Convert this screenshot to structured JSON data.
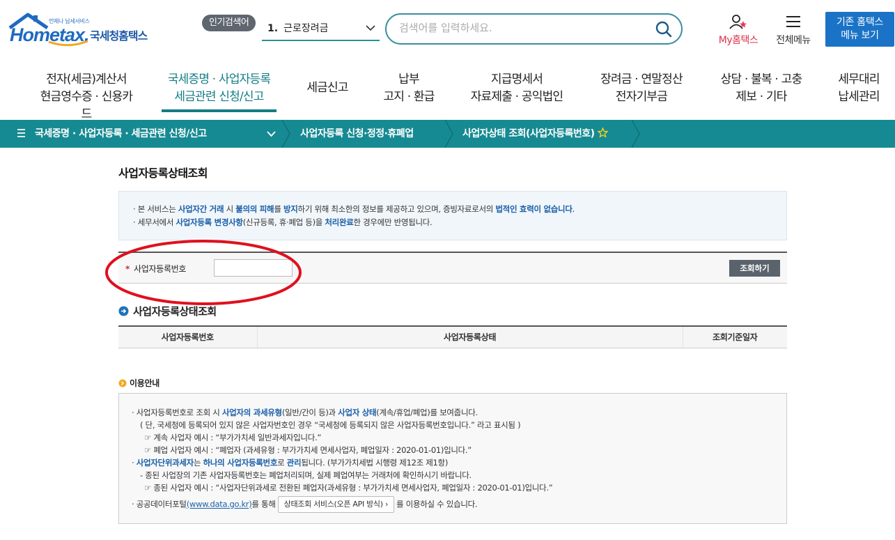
{
  "header": {
    "logo_small": "언제나 납세서비스",
    "logo_word": "Hometax.",
    "logo_kor": "국세청홈택스",
    "popular_badge": "인기검색어",
    "popular_rank": "1.",
    "popular_term": "근로장려금",
    "search_placeholder": "검색어를 입력하세요.",
    "myhome_label": "My홈택스",
    "allmenu_label": "전체메뉴",
    "legacy_line1": "기존 홈택스",
    "legacy_line2": "메뉴 보기"
  },
  "gnb": [
    {
      "line1": "전자(세금)계산서",
      "line2": "현금영수증 · 신용카드"
    },
    {
      "line1": "국세증명 · 사업자등록",
      "line2": "세금관련 신청/신고"
    },
    {
      "line1": "세금신고",
      "line2": ""
    },
    {
      "line1": "납부",
      "line2": "고지 · 환급"
    },
    {
      "line1": "지급명세서",
      "line2": "자료제출 · 공익법인"
    },
    {
      "line1": "장려금 · 연말정산",
      "line2": "전자기부금"
    },
    {
      "line1": "상담 · 불복 · 고충",
      "line2": "제보 · 기타"
    },
    {
      "line1": "세무대리",
      "line2": "납세관리"
    }
  ],
  "breadcrumb": [
    "국세증명 · 사업자등록 · 세금관련 신청/신고",
    "사업자등록 신청·정정·휴폐업",
    "사업자상태 조회(사업자등록번호)"
  ],
  "page": {
    "title": "사업자등록상태조회",
    "notice": {
      "l1_a": "본 서비스는 ",
      "l1_b": "사업자간 거래",
      "l1_c": " 시 ",
      "l1_d": "불의의 피해",
      "l1_e": "를 ",
      "l1_f": "방지",
      "l1_g": "하기 위해 최소한의 정보를 제공하고 있으며, 증빙자료로서의 ",
      "l1_h": "법적인 효력이 없습니다",
      "l1_i": ".",
      "l2_a": "세무서에서 ",
      "l2_b": "사업자등록 변경사항",
      "l2_c": "(신규등록, 휴·폐업 등)을 ",
      "l2_d": "처리완료",
      "l2_e": "한 경우에만 반영됩니다."
    },
    "form": {
      "required_mark": "*",
      "label": "사업자등록번호",
      "input_value": "",
      "submit_label": "조회하기"
    },
    "result_title": "사업자등록상태조회",
    "result_columns": [
      "사업자등록번호",
      "사업자등록상태",
      "조회기준일자"
    ],
    "guide_title": "이용안내",
    "guide": {
      "g1_a": "사업자등록번호로 조회 시 ",
      "g1_b": "사업자의 과세유형",
      "g1_c": "(일반/간이 등)과 ",
      "g1_d": "사업자 상태",
      "g1_e": "(계속/휴업/폐업)를 보여줍니다.",
      "g2": "( 단, 국세청에 등록되어 있지 않은 사업자번호인 경우 “국세청에 등록되지 않은 사업자등록번호입니다.” 라고 표시됨 )",
      "g3": "계속 사업자 예시 : “부가가치세 일반과세자입니다.”",
      "g4": "폐업 사업자 예시 : “폐업자 (과세유형 : 부가가치세 면세사업자, 폐업일자 : 2020-01-01)입니다.”",
      "g5_a": "사업자단위과세자",
      "g5_b": "는 ",
      "g5_c": "하나의 사업자등록번호",
      "g5_d": "로 ",
      "g5_e": "관리",
      "g5_f": "됩니다. (부가가치세법 시행령 제12조 제1항)",
      "g6": "- 종된 사업장의 기존 사업자등록번호는 폐업처리되며, 실제 폐업여부는 거래처에 확인하시기 바랍니다.",
      "g7": "종된 사업자 예시 : “사업자단위과세로 전환된 폐업자(과세유형 : 부가가치세 면세사업자, 폐업일자 : 2020-01-01)입니다.”",
      "g8_a": "공공데이터포털",
      "g8_b": "(www.data.go.kr)",
      "g8_c": "를 통해",
      "g8_btn": "상태조회 서비스(오픈 API 방식)",
      "g8_d": "를 이용하실 수 있습니다."
    }
  },
  "colors": {
    "teal": "#168a92",
    "brand_blue": "#1e6bc0",
    "highlight": "#1a5fa8",
    "annotation_red": "#e0101e"
  }
}
